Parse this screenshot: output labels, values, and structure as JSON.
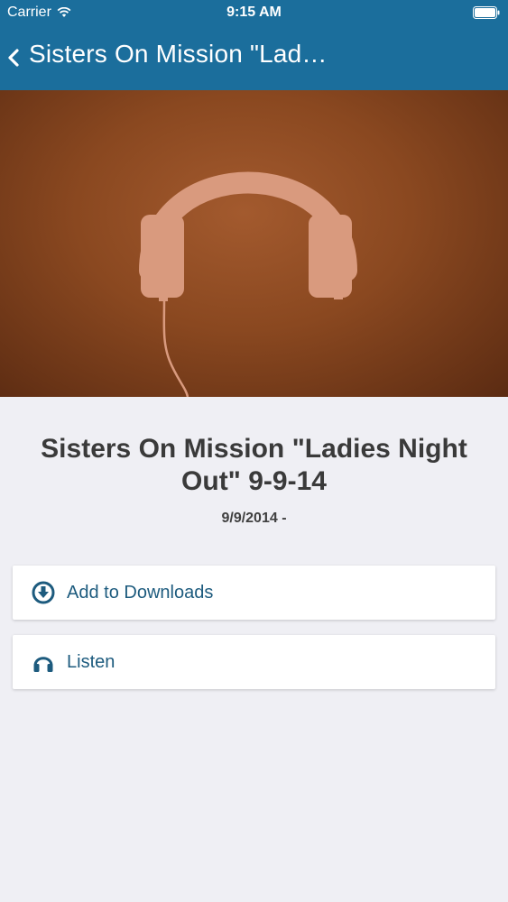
{
  "status_bar": {
    "carrier": "Carrier",
    "time": "9:15 AM"
  },
  "nav": {
    "title": "Sisters On Mission \"Lad…",
    "back_icon": "chevron-left-icon"
  },
  "hero": {
    "image": "headphones-illustration",
    "colors": {
      "background": "#8a4820",
      "headphones": "#d99a7e"
    }
  },
  "episode": {
    "title": "Sisters On Mission \"Ladies Night Out\" 9-9-14",
    "date": "9/9/2014 -"
  },
  "actions": [
    {
      "label": "Add to Downloads",
      "icon": "download-circle-icon"
    },
    {
      "label": "Listen",
      "icon": "headphones-icon"
    }
  ],
  "colors": {
    "nav_background": "#1b6e9c",
    "accent": "#1d5b7e",
    "page_background": "#efeff4"
  }
}
